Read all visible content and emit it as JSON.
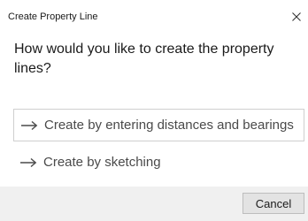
{
  "dialog": {
    "title": "Create Property Line",
    "prompt": "How would you like to create the property lines?",
    "options": [
      {
        "label": "Create by entering distances and bearings",
        "icon": "arrow-right-icon"
      },
      {
        "label": "Create by sketching",
        "icon": "arrow-right-icon"
      }
    ],
    "close_icon": "close-icon",
    "cancel_label": "Cancel"
  },
  "colors": {
    "footer_background": "#f0f0f0",
    "option_text": "#4a4a4a",
    "option_border": "#cfcfcf"
  }
}
